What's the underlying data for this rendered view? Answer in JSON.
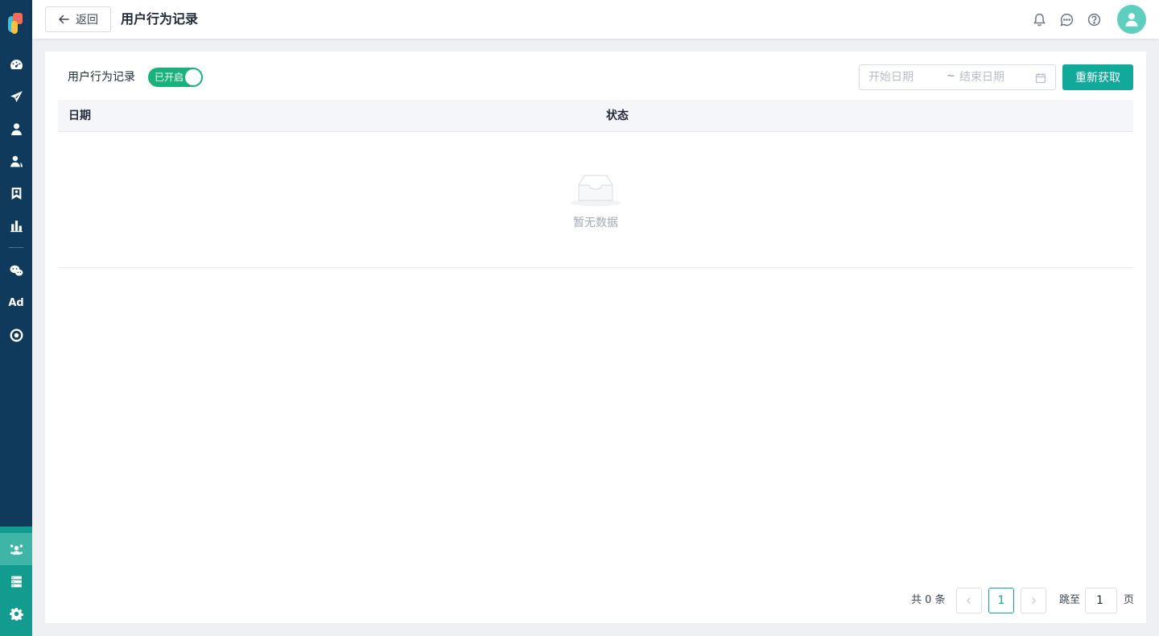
{
  "sidebar": {
    "nav": [
      {
        "icon": "dashboard-icon"
      },
      {
        "icon": "send-icon"
      },
      {
        "icon": "user-icon"
      },
      {
        "icon": "users-icon"
      },
      {
        "icon": "bookmark-icon"
      },
      {
        "icon": "bar-chart-icon"
      },
      {
        "icon": "wechat-icon"
      },
      {
        "label": "Ad"
      },
      {
        "icon": "target-icon"
      }
    ],
    "bottom": [
      {
        "icon": "network-icon",
        "active": true
      },
      {
        "icon": "server-icon"
      },
      {
        "icon": "gear-icon"
      }
    ],
    "colors": {
      "bg": "#0f3a5c",
      "bottom_bg": "#119c8f"
    }
  },
  "header": {
    "back_label": "返回",
    "title": "用户行为记录",
    "icons": [
      "bell-icon",
      "chat-icon",
      "help-icon",
      "avatar-icon"
    ]
  },
  "toolbar": {
    "label": "用户行为记录",
    "toggle_text": "已开启",
    "toggle_on": true,
    "date_start_placeholder": "开始日期",
    "date_separator": "~",
    "date_end_placeholder": "结束日期",
    "refetch_label": "重新获取"
  },
  "table": {
    "columns": [
      "日期",
      "状态"
    ],
    "rows": [],
    "empty_text": "暂无数据"
  },
  "pagination": {
    "total_text": "共 0 条",
    "current_page": "1",
    "jump_label": "跳至",
    "jump_value": "1",
    "page_suffix": "页"
  },
  "theme": {
    "accent": "#11a99a",
    "toggle_on_color": "#19b27a"
  }
}
